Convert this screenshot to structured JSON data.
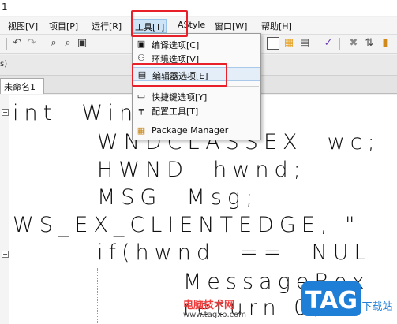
{
  "window": {
    "title_fragment": "1"
  },
  "menubar": {
    "items": [
      "视图[V]",
      "项目[P]",
      "运行[R]",
      "工具[T]",
      "AStyle",
      "窗口[W]",
      "帮助[H]"
    ]
  },
  "status_strip": {
    "text": "s)"
  },
  "tabs": [
    {
      "label": "未命名1"
    }
  ],
  "tools_menu": {
    "items": [
      {
        "label": "编译选项[C]",
        "icon": "compiler-options-icon"
      },
      {
        "label": "环境选项[V]",
        "icon": "environment-options-icon"
      },
      {
        "label": "编辑器选项[E]",
        "icon": "editor-options-icon"
      },
      {
        "label": "快捷键选项[Y]",
        "icon": "shortcut-options-icon"
      },
      {
        "label": "配置工具[T]",
        "icon": "configure-tools-icon"
      },
      {
        "label": "Package Manager",
        "icon": "package-manager-icon"
      }
    ]
  },
  "editor": {
    "lines": [
      {
        "text": "int  WinMain"
      },
      {
        "text": "WNDCLASSEX  wc;"
      },
      {
        "text": "HWND  hwnd;"
      },
      {
        "text": "MSG  Msg;"
      },
      {
        "text": "WS_EX_CLIENTEDGE, \""
      },
      {
        "text": "if(hwnd  ==  NUL"
      },
      {
        "text": "MessageBox"
      },
      {
        "text": "return 0;"
      }
    ]
  },
  "watermark": {
    "site_name": "电脑技术网",
    "url": "www.tagxp.com",
    "logo_text": "TAG",
    "logo_sub": "下载站"
  },
  "colors": {
    "highlight_box": "#e8202a",
    "menu_active": "#cde4f7",
    "logo_blue": "#1f7fd6"
  }
}
